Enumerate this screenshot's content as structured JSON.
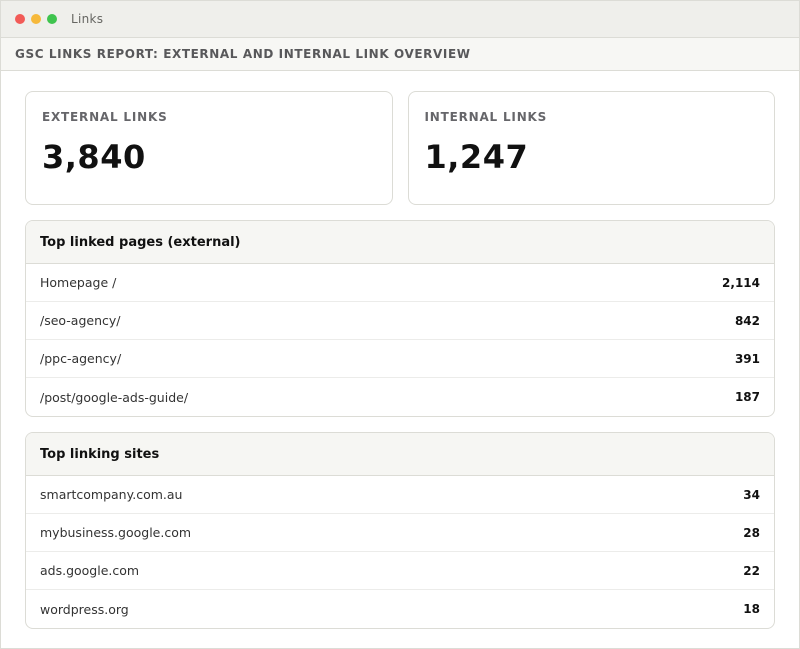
{
  "window": {
    "title": "Links",
    "controls": [
      "close",
      "minimize",
      "maximize"
    ],
    "colors": {
      "close": "#f25b57",
      "minimize": "#f6b93b",
      "maximize": "#3fc44e"
    }
  },
  "report": {
    "title": "GSC LINKS REPORT: EXTERNAL AND INTERNAL LINK OVERVIEW"
  },
  "stats": {
    "external": {
      "label": "EXTERNAL LINKS",
      "value": "3,840"
    },
    "internal": {
      "label": "INTERNAL LINKS",
      "value": "1,247"
    }
  },
  "top_linked_pages": {
    "title": "Top linked pages (external)",
    "rows": [
      {
        "name": "Homepage /",
        "count": "2,114"
      },
      {
        "name": "/seo-agency/",
        "count": "842"
      },
      {
        "name": "/ppc-agency/",
        "count": "391"
      },
      {
        "name": "/post/google-ads-guide/",
        "count": "187"
      }
    ]
  },
  "top_linking_sites": {
    "title": "Top linking sites",
    "rows": [
      {
        "name": "smartcompany.com.au",
        "count": "34"
      },
      {
        "name": "mybusiness.google.com",
        "count": "28"
      },
      {
        "name": "ads.google.com",
        "count": "22"
      },
      {
        "name": "wordpress.org",
        "count": "18"
      }
    ]
  }
}
